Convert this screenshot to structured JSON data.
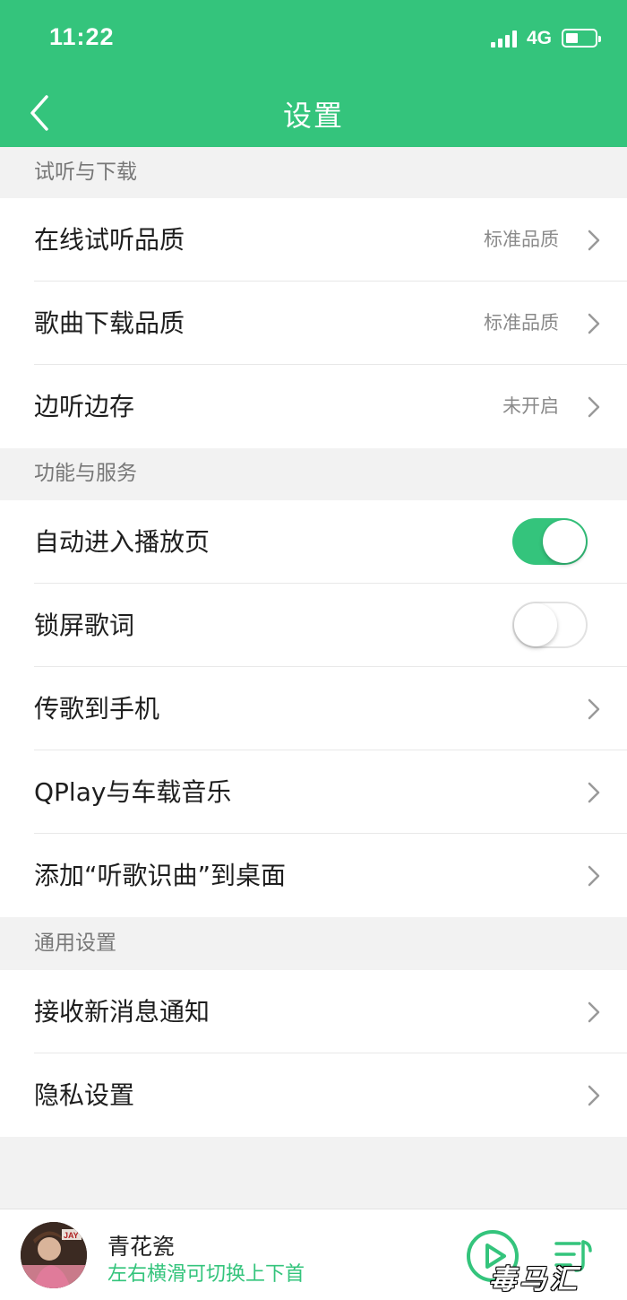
{
  "status_bar": {
    "time": "11:22",
    "network": "4G",
    "battery_level": 0.4
  },
  "nav": {
    "title": "设置"
  },
  "sections": [
    {
      "title": "试听与下载"
    },
    {
      "title": "功能与服务"
    },
    {
      "title": "通用设置"
    }
  ],
  "rows": {
    "online_quality": {
      "label": "在线试听品质",
      "value": "标准品质"
    },
    "download_quality": {
      "label": "歌曲下载品质",
      "value": "标准品质"
    },
    "cache_while_listening": {
      "label": "边听边存",
      "value": "未开启"
    },
    "auto_player_page": {
      "label": "自动进入播放页",
      "toggle": true
    },
    "lockscreen_lyrics": {
      "label": "锁屏歌词",
      "toggle": false
    },
    "transfer_to_phone": {
      "label": "传歌到手机"
    },
    "qplay": {
      "label": "QPlay与车载音乐"
    },
    "add_song_recognition": {
      "label": "添加“听歌识曲”到桌面"
    },
    "notifications": {
      "label": "接收新消息通知"
    },
    "privacy": {
      "label": "隐私设置"
    }
  },
  "player": {
    "song_title": "青花瓷",
    "hint": "左右横滑可切换上下首"
  },
  "watermark": "毒马汇",
  "colors": {
    "accent": "#34c47c",
    "background": "#f2f2f2"
  },
  "icons": [
    "back-arrow-icon",
    "chevron-right-icon",
    "play-icon",
    "playlist-icon",
    "signal-icon",
    "battery-icon"
  ]
}
